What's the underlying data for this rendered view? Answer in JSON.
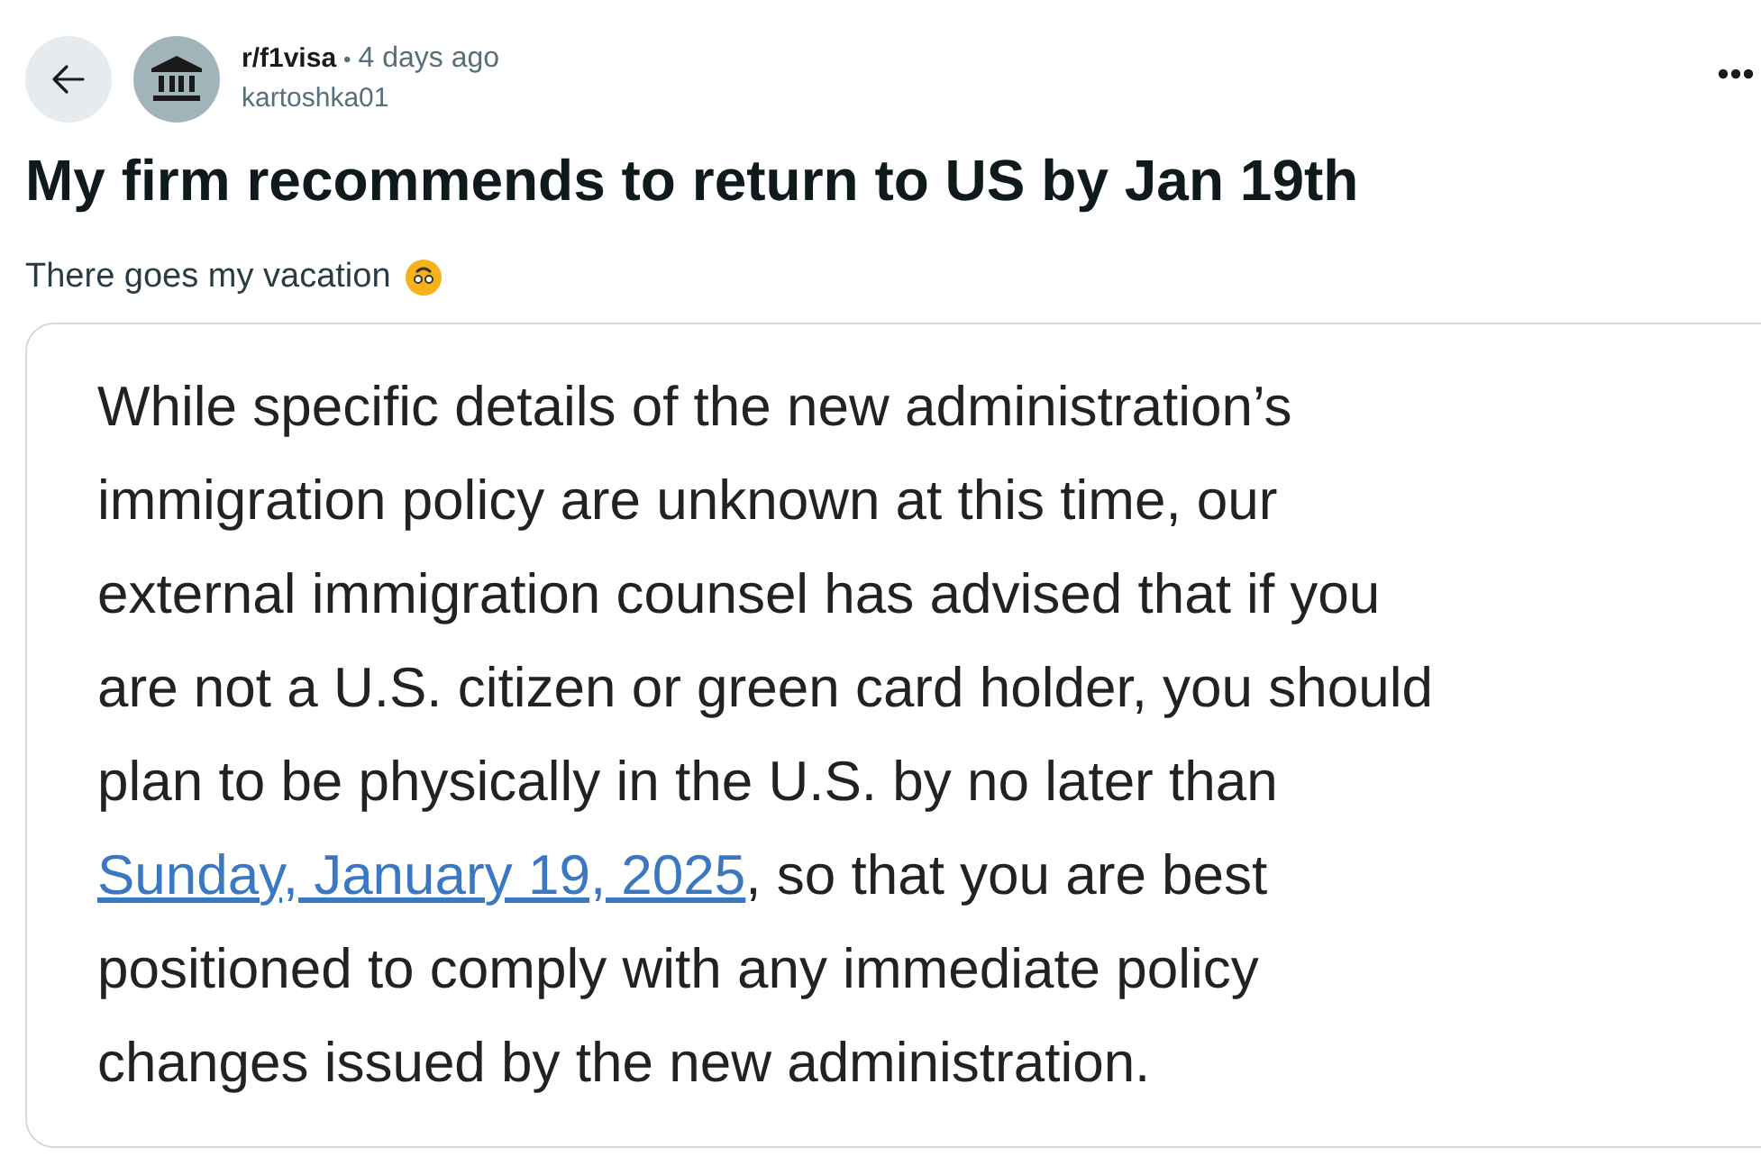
{
  "post": {
    "subreddit": "r/f1visa",
    "separator": "•",
    "time": "4 days ago",
    "author": "kartoshka01",
    "title": "My firm recommends to return to US by Jan 19th",
    "body": "There goes my vacation"
  },
  "image": {
    "lines": [
      [
        {
          "kind": "plain",
          "text": "While specific details of the new administration’s"
        }
      ],
      [
        {
          "kind": "plain",
          "text": "immigration policy are unknown at this time, our"
        }
      ],
      [
        {
          "kind": "plain",
          "text": "external immigration counsel has advised that if you"
        }
      ],
      [
        {
          "kind": "plain",
          "text": "are not a U.S. citizen or green card holder, you should"
        }
      ],
      [
        {
          "kind": "plain",
          "text": "plan to be physically in the U.S. by no later than"
        }
      ],
      [
        {
          "kind": "link",
          "text": "Sunday, January 19, 2025"
        },
        {
          "kind": "plain",
          "text": ", so that you are best"
        }
      ],
      [
        {
          "kind": "plain",
          "text": "positioned to comply with any immediate policy"
        }
      ],
      [
        {
          "kind": "plain",
          "text": "changes issued by the new administration."
        }
      ]
    ]
  }
}
